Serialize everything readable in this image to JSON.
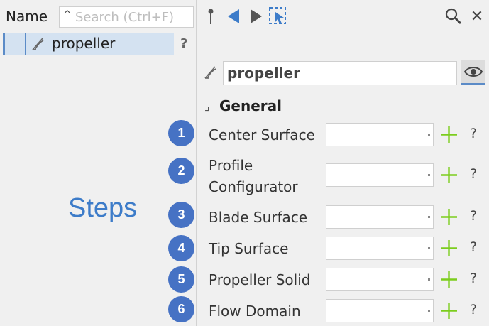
{
  "tree": {
    "column_header": "Name",
    "search_placeholder": "Search (Ctrl+F)",
    "item_label": "propeller",
    "help": "?"
  },
  "annotation": {
    "steps_label": "Steps"
  },
  "properties": {
    "object_name": "propeller",
    "group_title": "General",
    "group_marker": "⌟",
    "fields": [
      {
        "step": "1",
        "label": "Center Surface",
        "value": "",
        "help": "?"
      },
      {
        "step": "2",
        "label": "Profile Configurator",
        "value": "",
        "help": "?"
      },
      {
        "step": "3",
        "label": "Blade Surface",
        "value": "",
        "help": "?"
      },
      {
        "step": "4",
        "label": "Tip Surface",
        "value": "",
        "help": "?"
      },
      {
        "step": "5",
        "label": "Propeller Solid",
        "value": "",
        "help": "?"
      },
      {
        "step": "6",
        "label": "Flow Domain",
        "value": "",
        "help": "?"
      }
    ]
  },
  "toolbar": {
    "icons": [
      "pin-icon",
      "back-arrow-icon",
      "forward-arrow-icon",
      "select-cursor-icon",
      "search-icon",
      "close-icon"
    ],
    "close_glyph": "✕"
  },
  "colors": {
    "accent": "#4672c4",
    "steps_text": "#3d7cc9",
    "add_green": "#7ccd1e",
    "selection": "#d4e2f1"
  }
}
